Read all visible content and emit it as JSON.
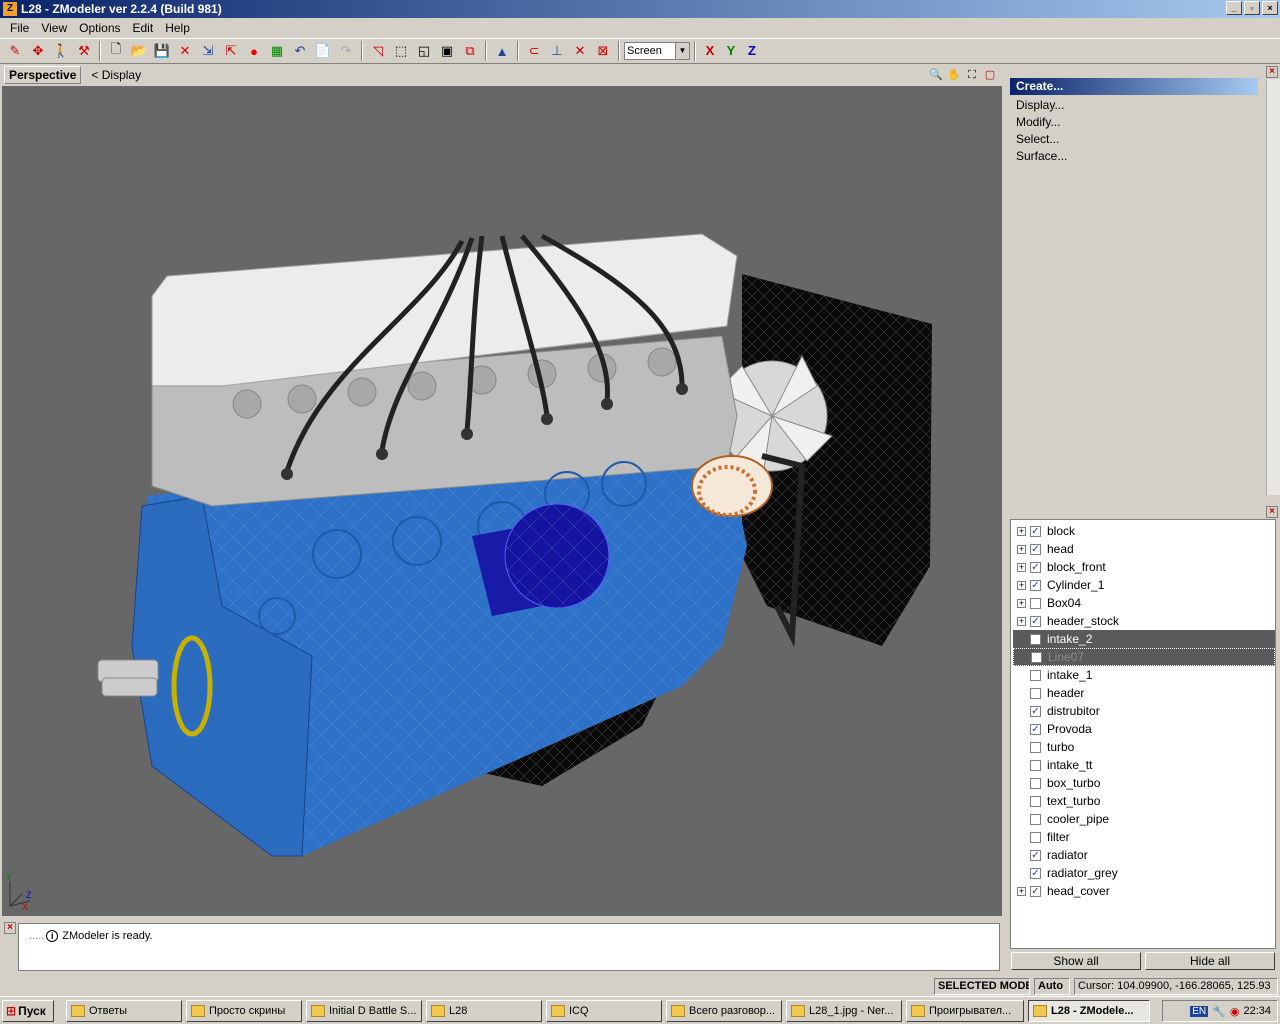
{
  "window": {
    "title": "L28 - ZModeler ver 2.2.4 (Build 981)",
    "icon": "Z",
    "controls": [
      "_",
      "▫",
      "×"
    ]
  },
  "menu": [
    "File",
    "View",
    "Options",
    "Edit",
    "Help"
  ],
  "toolbar": {
    "coord_select": "Screen",
    "axes": [
      {
        "label": "X",
        "color": "#c00000"
      },
      {
        "label": "Y",
        "color": "#008000"
      },
      {
        "label": "Z",
        "color": "#0000c0"
      }
    ]
  },
  "viewport": {
    "tab": "Perspective",
    "display_link": "<  Display",
    "axis_labels": [
      "Y",
      "X",
      "Z"
    ]
  },
  "right_panel": {
    "header": "Create...",
    "items": [
      "Display...",
      "Modify...",
      "Select...",
      "Surface..."
    ],
    "close": "×"
  },
  "objects": [
    {
      "name": "block",
      "expandable": true,
      "checked": true,
      "state": ""
    },
    {
      "name": "head",
      "expandable": true,
      "checked": true,
      "state": ""
    },
    {
      "name": "block_front",
      "expandable": true,
      "checked": true,
      "state": ""
    },
    {
      "name": "Cylinder_1",
      "expandable": true,
      "checked": true,
      "state": ""
    },
    {
      "name": "Box04",
      "expandable": true,
      "checked": false,
      "state": ""
    },
    {
      "name": "header_stock",
      "expandable": true,
      "checked": true,
      "state": ""
    },
    {
      "name": "intake_2",
      "expandable": false,
      "checked": false,
      "state": "sel"
    },
    {
      "name": "Line07",
      "expandable": false,
      "checked": false,
      "state": "sel2"
    },
    {
      "name": "intake_1",
      "expandable": false,
      "checked": false,
      "state": ""
    },
    {
      "name": "header",
      "expandable": false,
      "checked": false,
      "state": ""
    },
    {
      "name": "distrubitor",
      "expandable": false,
      "checked": true,
      "state": ""
    },
    {
      "name": "Provoda",
      "expandable": false,
      "checked": true,
      "state": ""
    },
    {
      "name": "turbo",
      "expandable": false,
      "checked": false,
      "state": ""
    },
    {
      "name": "intake_tt",
      "expandable": false,
      "checked": false,
      "state": ""
    },
    {
      "name": "box_turbo",
      "expandable": false,
      "checked": false,
      "state": ""
    },
    {
      "name": "text_turbo",
      "expandable": false,
      "checked": false,
      "state": ""
    },
    {
      "name": "cooler_pipe",
      "expandable": false,
      "checked": false,
      "state": ""
    },
    {
      "name": "filter",
      "expandable": false,
      "checked": false,
      "state": ""
    },
    {
      "name": "radiator",
      "expandable": false,
      "checked": true,
      "state": ""
    },
    {
      "name": "radiator_grey",
      "expandable": false,
      "checked": true,
      "state": ""
    },
    {
      "name": "head_cover",
      "expandable": true,
      "checked": true,
      "state": ""
    }
  ],
  "buttons": {
    "show_all": "Show all",
    "hide_all": "Hide all"
  },
  "log": {
    "message": "ZModeler is ready."
  },
  "status": {
    "mode": "SELECTED MODE",
    "auto": "Auto",
    "cursor": "Cursor: 104.09900, -166.28065, 125.93"
  },
  "taskbar": {
    "start": "Пуск",
    "tasks": [
      "Ответы",
      "Просто скрины",
      "Initial D Battle S...",
      "L28",
      "ICQ",
      "Всего разговор...",
      "L28_1.jpg - Ner...",
      "Проигрывател...",
      "L28 - ZModele..."
    ],
    "lang": "EN",
    "clock": "22:34"
  }
}
